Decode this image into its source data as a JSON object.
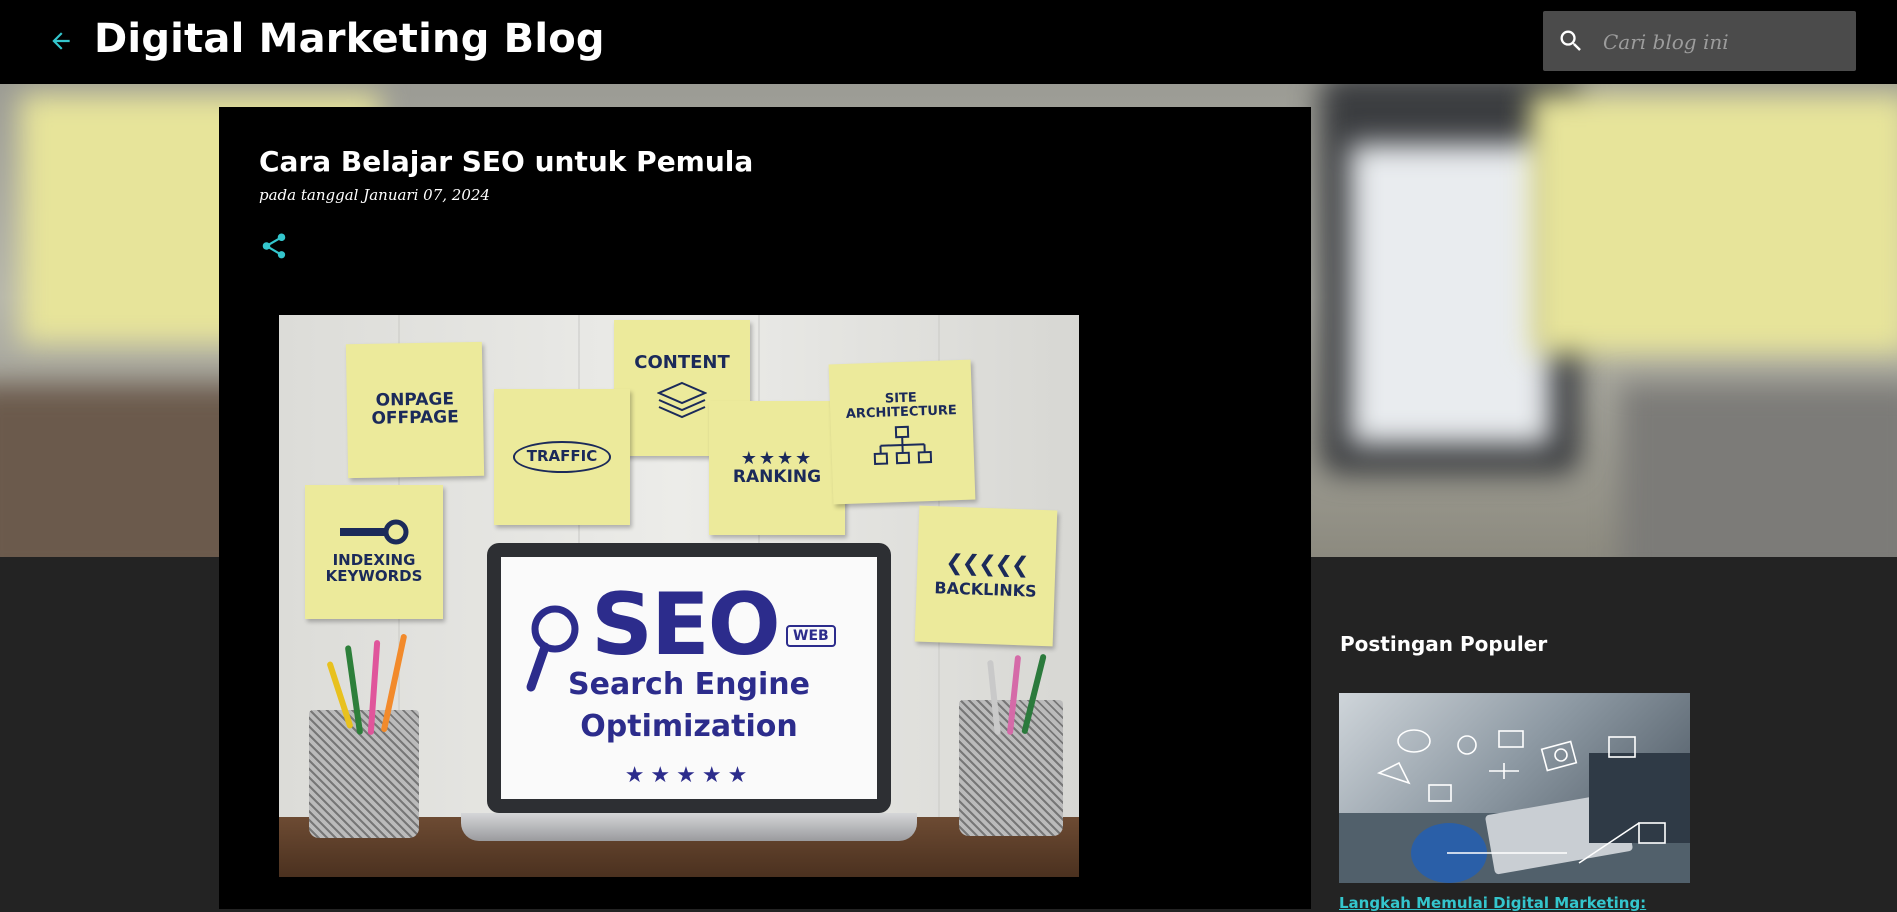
{
  "header": {
    "back_icon": "arrow-left-icon",
    "blog_title": "Digital Marketing Blog",
    "search": {
      "icon": "search-icon",
      "placeholder": "Cari blog ini"
    },
    "accent_color": "#34c6cd"
  },
  "post": {
    "title": "Cara Belajar SEO untuk Pemula",
    "date_line": "pada tanggal Januari 07, 2024",
    "share_icon": "share-icon",
    "image": {
      "notes": {
        "onpage": "ONPAGE",
        "offpage": "OFFPAGE",
        "content": "CONTENT",
        "site": "SITE",
        "architecture": "ARCHITECTURE",
        "traffic": "TRAFFIC",
        "ranking": "RANKING",
        "indexing": "INDEXING",
        "keywords": "KEYWORDS",
        "backlinks": "BACKLINKS"
      },
      "screen": {
        "seo": "SEO",
        "web": "WEB",
        "search_engine": "Search Engine",
        "optimization": "Optimization",
        "stars": "★★★★★"
      }
    }
  },
  "sidebar": {
    "heading": "Postingan Populer",
    "popular_posts": [
      {
        "title": "Langkah Memulai Digital Marketing:"
      }
    ]
  }
}
